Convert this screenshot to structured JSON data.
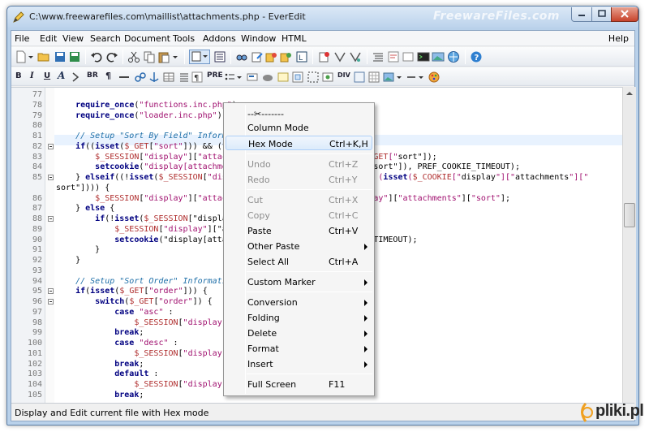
{
  "window": {
    "title": "C:\\www.freewarefiles.com\\maillist\\attachments.php - EverEdit",
    "watermark": "FreewareFiles.com"
  },
  "menubar": {
    "items": [
      "File",
      "Edit",
      "View",
      "Search",
      "Document",
      "Tools",
      "Addons",
      "Window",
      "HTML"
    ],
    "help": "Help"
  },
  "toolbar2_text": {
    "br": "BR",
    "pre": "PRE",
    "div": "DIV"
  },
  "editor": {
    "lines": [
      {
        "n": "77",
        "code": ""
      },
      {
        "n": "78",
        "code": "    require_once(\"functions.inc.php\");"
      },
      {
        "n": "79",
        "code": "    require_once(\"loader.inc.php\");"
      },
      {
        "n": "80",
        "code": ""
      },
      {
        "n": "81",
        "code": "    // Setup \"Sort By Field\" Informa"
      },
      {
        "n": "82",
        "code": "    if((isset($_GET[\"sort\"])) && (tr"
      },
      {
        "n": "83",
        "code": "        $_SESSION[\"display\"][\"attach                           $_GET[\"sort\"]);"
      },
      {
        "n": "84",
        "code": "        setcookie(\"display[attachmen                            \"sort\"]), PREF_COOKIE_TIMEOUT);"
      },
      {
        "n": "85",
        "code": "    } elseif((!isset($_SESSION[\"dis                            && (isset($_COOKIE[\"display\"][\"attachments\"][\""
      },
      {
        "n": "",
        "code": "sort\"]))) {"
      },
      {
        "n": "86",
        "code": "        $_SESSION[\"display\"][\"attach                          splay\"][\"attachments\"][\"sort\"];"
      },
      {
        "n": "87",
        "code": "    } else {"
      },
      {
        "n": "88",
        "code": "        if(!isset($_SESSION[\"display"
      },
      {
        "n": "89",
        "code": "            $_SESSION[\"display\"][\"at"
      },
      {
        "n": "90",
        "code": "            setcookie(\"display[attac                       OOKIE_TIMEOUT);"
      },
      {
        "n": "91",
        "code": "        }"
      },
      {
        "n": "92",
        "code": "    }"
      },
      {
        "n": "93",
        "code": ""
      },
      {
        "n": "94",
        "code": "    // Setup \"Sort Order\" Informatio"
      },
      {
        "n": "95",
        "code": "    if(isset($_GET[\"order\"])) {"
      },
      {
        "n": "96",
        "code": "        switch($_GET[\"order\"]) {"
      },
      {
        "n": "97",
        "code": "            case \"asc\" :"
      },
      {
        "n": "98",
        "code": "                $_SESSION[\"display\"]                       \";"
      },
      {
        "n": "99",
        "code": "            break;"
      },
      {
        "n": "100",
        "code": "            case \"desc\" :"
      },
      {
        "n": "101",
        "code": "                $_SESSION[\"display\"]                       SC\";"
      },
      {
        "n": "102",
        "code": "            break;"
      },
      {
        "n": "103",
        "code": "            default :"
      },
      {
        "n": "104",
        "code": "                $_SESSION[\"display\"]                       \";"
      },
      {
        "n": "105",
        "code": "            break;"
      }
    ]
  },
  "context_menu": {
    "items": [
      {
        "label": "--✂-------",
        "shortcut": "",
        "submenu": false,
        "disabled": false
      },
      {
        "label": "Column Mode",
        "shortcut": "",
        "submenu": false,
        "disabled": false
      },
      {
        "label": "Hex Mode",
        "shortcut": "Ctrl+K,H",
        "submenu": false,
        "disabled": false
      },
      {
        "label": "Undo",
        "shortcut": "Ctrl+Z",
        "submenu": false,
        "disabled": true
      },
      {
        "label": "Redo",
        "shortcut": "Ctrl+Y",
        "submenu": false,
        "disabled": true
      },
      {
        "label": "Cut",
        "shortcut": "Ctrl+X",
        "submenu": false,
        "disabled": true
      },
      {
        "label": "Copy",
        "shortcut": "Ctrl+C",
        "submenu": false,
        "disabled": true
      },
      {
        "label": "Paste",
        "shortcut": "Ctrl+V",
        "submenu": false,
        "disabled": false
      },
      {
        "label": "Other Paste",
        "shortcut": "",
        "submenu": true,
        "disabled": false
      },
      {
        "label": "Select All",
        "shortcut": "Ctrl+A",
        "submenu": false,
        "disabled": false
      },
      {
        "label": "Custom Marker",
        "shortcut": "",
        "submenu": true,
        "disabled": false
      },
      {
        "label": "Conversion",
        "shortcut": "",
        "submenu": true,
        "disabled": false
      },
      {
        "label": "Folding",
        "shortcut": "",
        "submenu": true,
        "disabled": false
      },
      {
        "label": "Delete",
        "shortcut": "",
        "submenu": true,
        "disabled": false
      },
      {
        "label": "Format",
        "shortcut": "",
        "submenu": true,
        "disabled": false
      },
      {
        "label": "Insert",
        "shortcut": "",
        "submenu": true,
        "disabled": false
      },
      {
        "label": "Full Screen",
        "shortcut": "F11",
        "submenu": false,
        "disabled": false
      }
    ]
  },
  "statusbar": {
    "text": "Display and Edit current file with Hex mode"
  },
  "logo": {
    "text": "pliki.pl"
  },
  "colors": {
    "accent": "#aecff7",
    "titlebar": "#bcd3ec",
    "close": "#c7432c"
  }
}
